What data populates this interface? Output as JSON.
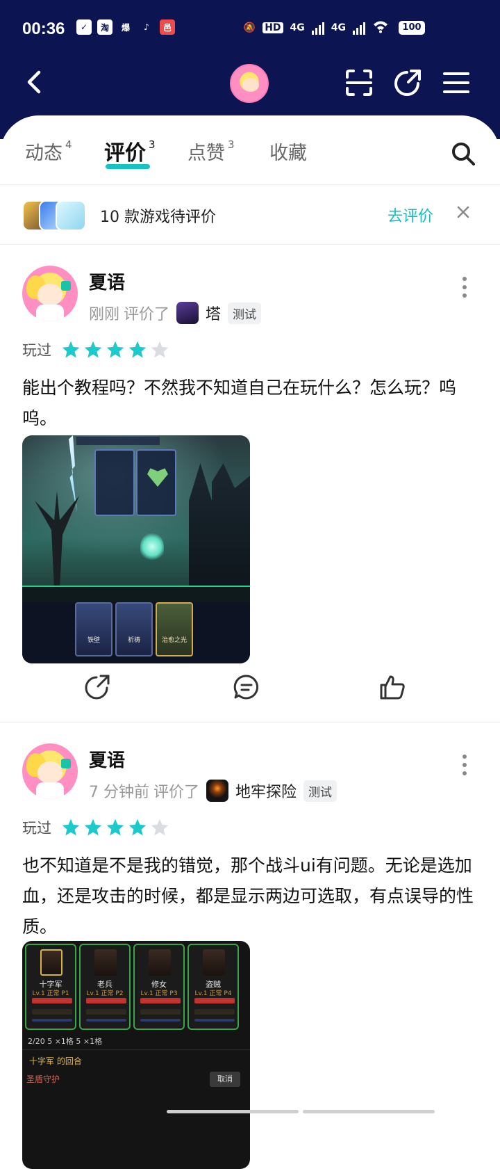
{
  "status_bar": {
    "time": "00:36",
    "left_icons": [
      "task-icon",
      "taobao-icon",
      "flame-icon",
      "tiktok-icon",
      "app-icon"
    ],
    "network_1": "4G",
    "network_2": "4G",
    "hd_label": "HD",
    "battery": "100"
  },
  "header": {
    "back_icon": "back-arrow-icon",
    "scan_icon": "scan-icon",
    "share_icon": "share-icon",
    "menu_icon": "menu-icon"
  },
  "tabs": [
    {
      "label": "动态",
      "count": "4"
    },
    {
      "label": "评价",
      "count": "3"
    },
    {
      "label": "点赞",
      "count": "3"
    },
    {
      "label": "收藏",
      "count": ""
    }
  ],
  "pending": {
    "text": "10 款游戏待评价",
    "action": "去评价"
  },
  "reviews": [
    {
      "name": "夏语",
      "time": "刚刚",
      "verb": "评价了",
      "game": "塔",
      "tag": "测试",
      "played": "玩过",
      "rating": 4,
      "content": "能出个教程吗？不然我不知道自己在玩什么？怎么玩？呜呜。",
      "screenshot_labels": {
        "card1": "铁壁",
        "card2": "祈祷",
        "card3": "治愈之光"
      }
    },
    {
      "name": "夏语",
      "time": "7 分钟前",
      "verb": "评价了",
      "game": "地牢探险",
      "tag": "测试",
      "played": "玩过",
      "rating": 4,
      "content": "也不知道是不是我的错觉，那个战斗ui有问题。无论是选加血，还是攻击的时候，都是显示两边可选取，有点误导的性质。",
      "screenshot_labels": {
        "slot1": "十字军",
        "slot2": "老兵",
        "slot3": "修女",
        "slot4": "盗贼",
        "slot1_lv": "Lv.1 正常 P1",
        "slot2_lv": "Lv.1 正常 P2",
        "slot3_lv": "Lv.1 正常 P3",
        "slot4_lv": "Lv.1 正常 P4",
        "resources": "2/20  5 ×1格  5 ×1格",
        "turn": "十字军 的回合",
        "skill": "圣盾守护",
        "cancel": "取消"
      }
    }
  ],
  "colors": {
    "header_bg": "#0c1551",
    "accent": "#16c2c2",
    "star_on": "#1ec9c9",
    "star_off": "#d9dce0"
  }
}
